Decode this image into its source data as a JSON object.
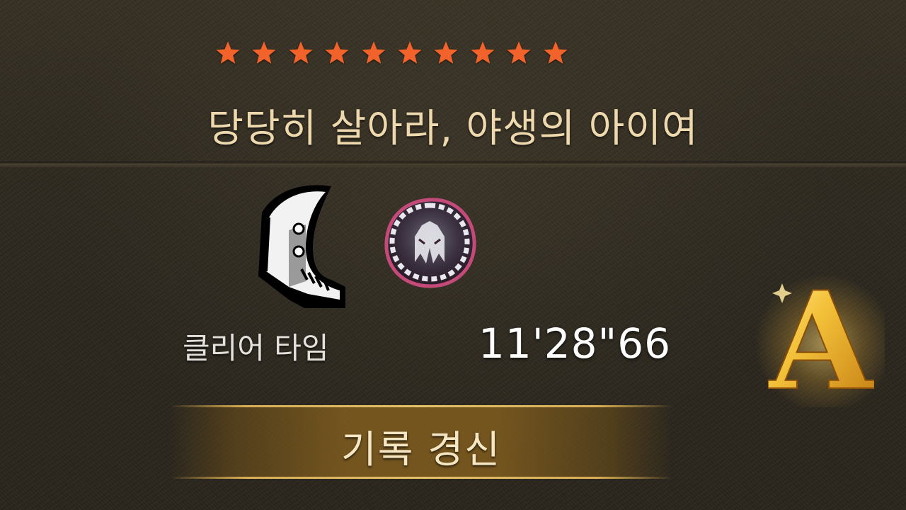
{
  "result": {
    "rating": {
      "stars": 10,
      "max": 10,
      "star_color": "#f2622b"
    },
    "quest_title": "당당히 살아라, 야생의 아이여",
    "weapon_icon": "great-sword-weapon-icon",
    "monster_icon": "tempered-monster-icon",
    "clear_time_label": "클리어 타임",
    "clear_time_value": "11'28\"66",
    "rank": "A",
    "rank_color": "#f0b626",
    "record_label": "기록 경신"
  }
}
